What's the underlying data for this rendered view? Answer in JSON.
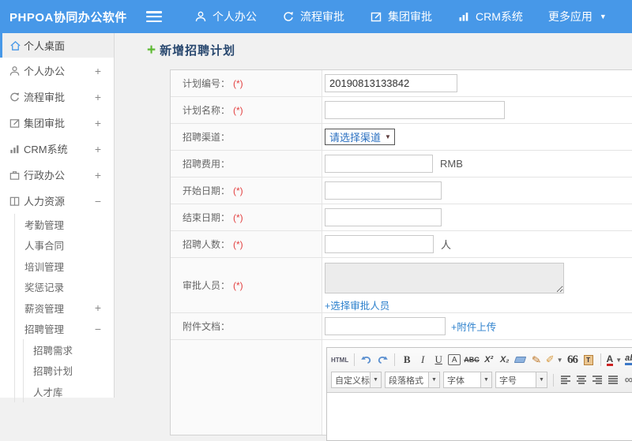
{
  "colors": {
    "accent_blue": "#4798e8",
    "link_blue": "#2f82cd",
    "required_red": "#e34141",
    "title_navy": "#29486f",
    "plus_green": "#5cb832"
  },
  "topbar": {
    "logo": "PHPOA协同办公软件",
    "caret": "▼",
    "nav": [
      {
        "label": "个人办公"
      },
      {
        "label": "流程审批"
      },
      {
        "label": "集团审批"
      },
      {
        "label": "CRM系统"
      },
      {
        "label": "更多应用"
      }
    ]
  },
  "sidebar": {
    "items": [
      {
        "label": "个人桌面",
        "suffix": ""
      },
      {
        "label": "个人办公",
        "suffix": "+"
      },
      {
        "label": "流程审批",
        "suffix": "+"
      },
      {
        "label": "集团审批",
        "suffix": "+"
      },
      {
        "label": "CRM系统",
        "suffix": "+"
      },
      {
        "label": "行政办公",
        "suffix": "+"
      },
      {
        "label": "人力资源",
        "suffix": "−"
      },
      {
        "label": "考勤管理",
        "suffix": ""
      },
      {
        "label": "人事合同",
        "suffix": ""
      },
      {
        "label": "培训管理",
        "suffix": ""
      },
      {
        "label": "奖惩记录",
        "suffix": ""
      },
      {
        "label": "薪资管理",
        "suffix": "+"
      },
      {
        "label": "招聘管理",
        "suffix": "−"
      },
      {
        "label": "招聘需求",
        "suffix": ""
      },
      {
        "label": "招聘计划",
        "suffix": ""
      },
      {
        "label": "人才库",
        "suffix": ""
      }
    ]
  },
  "main": {
    "title": "新增招聘计划",
    "form": {
      "required_marker": "(*)",
      "rows": {
        "plan_no": {
          "label": "计划编号：",
          "value": "20190813133842"
        },
        "plan_name": {
          "label": "计划名称："
        },
        "channel": {
          "label": "招聘渠道：",
          "select_value": "请选择渠道",
          "caret": "▼"
        },
        "cost": {
          "label": "招聘费用：",
          "unit": "RMB"
        },
        "start_date": {
          "label": "开始日期："
        },
        "end_date": {
          "label": "结束日期："
        },
        "headcount": {
          "label": "招聘人数：",
          "unit": "人"
        },
        "approvers": {
          "label": "审批人员：",
          "link": "+选择审批人员"
        },
        "attachment": {
          "label": "附件文档：",
          "link": "+附件上传"
        }
      }
    },
    "editor": {
      "source_label": "HTML",
      "caret": "▼",
      "buttons": {
        "bold": "B",
        "italic": "I",
        "underline": "U",
        "fontborder": "A",
        "strikethrough": "ABC",
        "superscript": "X²",
        "subscript": "X₂",
        "blockquote": "66",
        "paste_letter": "T",
        "forecolor": "A",
        "backcolor": "ab"
      },
      "dropdowns": [
        {
          "label": "自定义标题"
        },
        {
          "label": "段落格式"
        },
        {
          "label": "字体"
        },
        {
          "label": "字号"
        }
      ]
    }
  }
}
